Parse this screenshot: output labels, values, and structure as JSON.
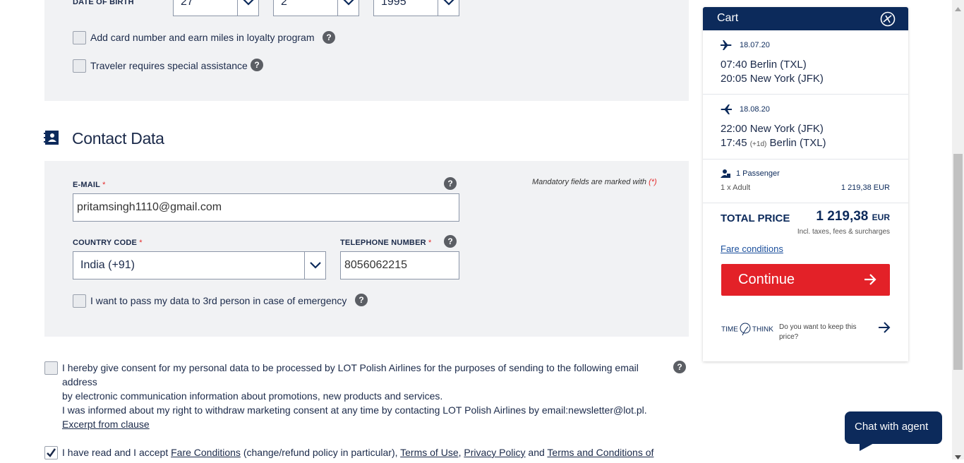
{
  "traveler": {
    "dob_label": "DATE OF BIRTH",
    "dob_day": "27",
    "dob_month": "2",
    "dob_year": "1995",
    "loyalty_label": "Add card number and earn miles in loyalty program",
    "assistance_label": "Traveler requires special assistance"
  },
  "contact": {
    "title": "Contact Data",
    "mandatory_note": "Mandatory fields are marked with",
    "mandatory_mark": "(*)",
    "email_label": "E-MAIL",
    "email_value": "pritamsingh1110@gmail.com",
    "country_label": "COUNTRY CODE",
    "country_value": "India (+91)",
    "phone_label": "TELEPHONE NUMBER",
    "phone_value": "8056062215",
    "required_mark": "*",
    "emergency_label": "I want to pass my data to 3rd person in case of emergency"
  },
  "consent": {
    "line1": "I hereby give consent for my personal data to be processed by LOT Polish Airlines for the purposes of sending to the following email address",
    "line2": "by electronic communication information about promotions, new products and services.",
    "line3": "I was informed about my right to withdraw marketing consent at any time by contacting LOT Polish Airlines by email:newsletter@lot.pl.",
    "excerpt_link": "Excerpt from clause",
    "accept_prefix": "I have read and I accept",
    "fare_conditions": "Fare Conditions",
    "accept_mid": "(change/refund policy in particular),",
    "terms_of_use": "Terms of Use",
    "comma": ",",
    "privacy_policy": "Privacy Policy",
    "and": "and",
    "terms_conditions": "Terms and Conditions of"
  },
  "cart": {
    "title": "Cart",
    "outbound_date": "18.07.20",
    "outbound_dep": "07:40 Berlin (TXL)",
    "outbound_arr": "20:05 New York (JFK)",
    "return_date": "18.08.20",
    "return_dep": "22:00 New York (JFK)",
    "return_arr_time": "17:45",
    "return_arr_plus": "(+1d)",
    "return_arr_city": "Berlin (TXL)",
    "passengers": "1 Passenger",
    "pax_type": "1 x Adult",
    "pax_price": "1 219,38 EUR",
    "total_label": "TOTAL PRICE",
    "total_value": "1 219,38",
    "total_currency": "EUR",
    "total_note": "Incl. taxes, fees & surcharges",
    "fare_link": "Fare conditions",
    "continue_label": "Continue",
    "time2think": "TIME",
    "time2think_2": "THINK",
    "keep_price": "Do you want to keep this price?"
  },
  "chat": {
    "label": "Chat with agent"
  },
  "colors": {
    "brand": "#0c2a5b",
    "cta": "#e32128",
    "panel": "#f1f2f4"
  }
}
